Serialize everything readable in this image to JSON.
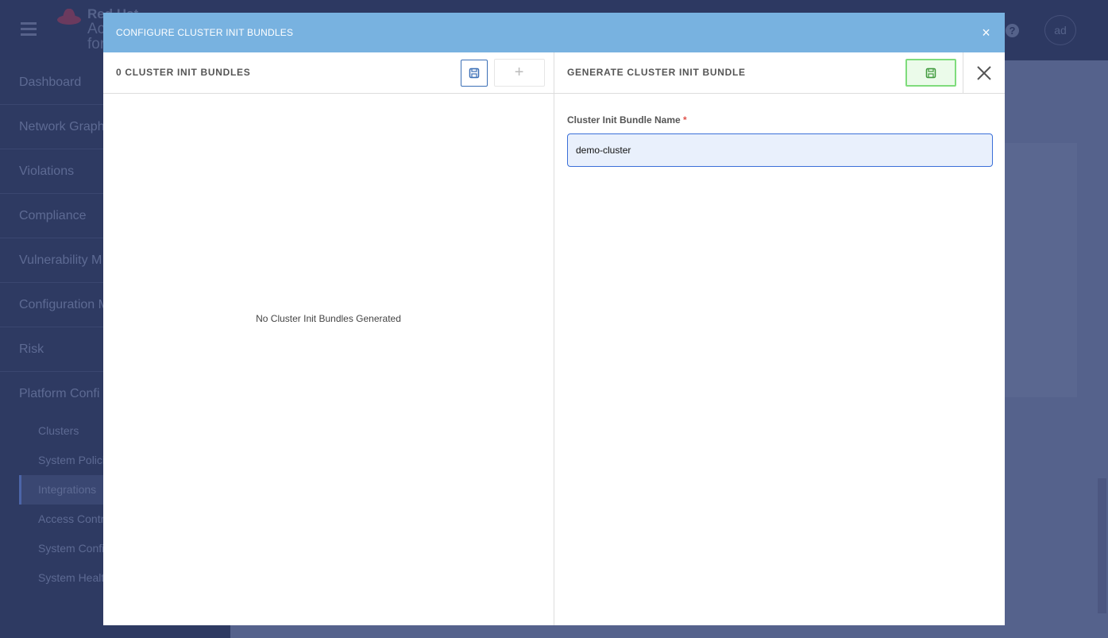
{
  "header": {
    "brand_lines": [
      "Red Hat",
      "Ac",
      "for"
    ],
    "user_initials": "ad"
  },
  "sidebar": {
    "items": [
      "Dashboard",
      "Network Graph",
      "Violations",
      "Compliance",
      "Vulnerability M",
      "Configuration M",
      "Risk",
      "Platform Confi"
    ],
    "sub_items": [
      "Clusters",
      "System Polici",
      "Integrations",
      "Access Contr",
      "System Confi",
      "System Healt"
    ],
    "active": "Integrations"
  },
  "modal": {
    "title": "CONFIGURE CLUSTER INIT BUNDLES",
    "left": {
      "title": "0 CLUSTER INIT BUNDLES",
      "add_label": "+",
      "empty_text": "No Cluster Init Bundles Generated"
    },
    "right": {
      "title": "GENERATE CLUSTER INIT BUNDLE",
      "field_label": "Cluster Init Bundle Name",
      "required_mark": "*",
      "field_value": "demo-cluster"
    }
  },
  "colors": {
    "modal_header": "#78b2e0",
    "save_green": "#7fdc7c",
    "input_border": "#3a6fd8"
  }
}
